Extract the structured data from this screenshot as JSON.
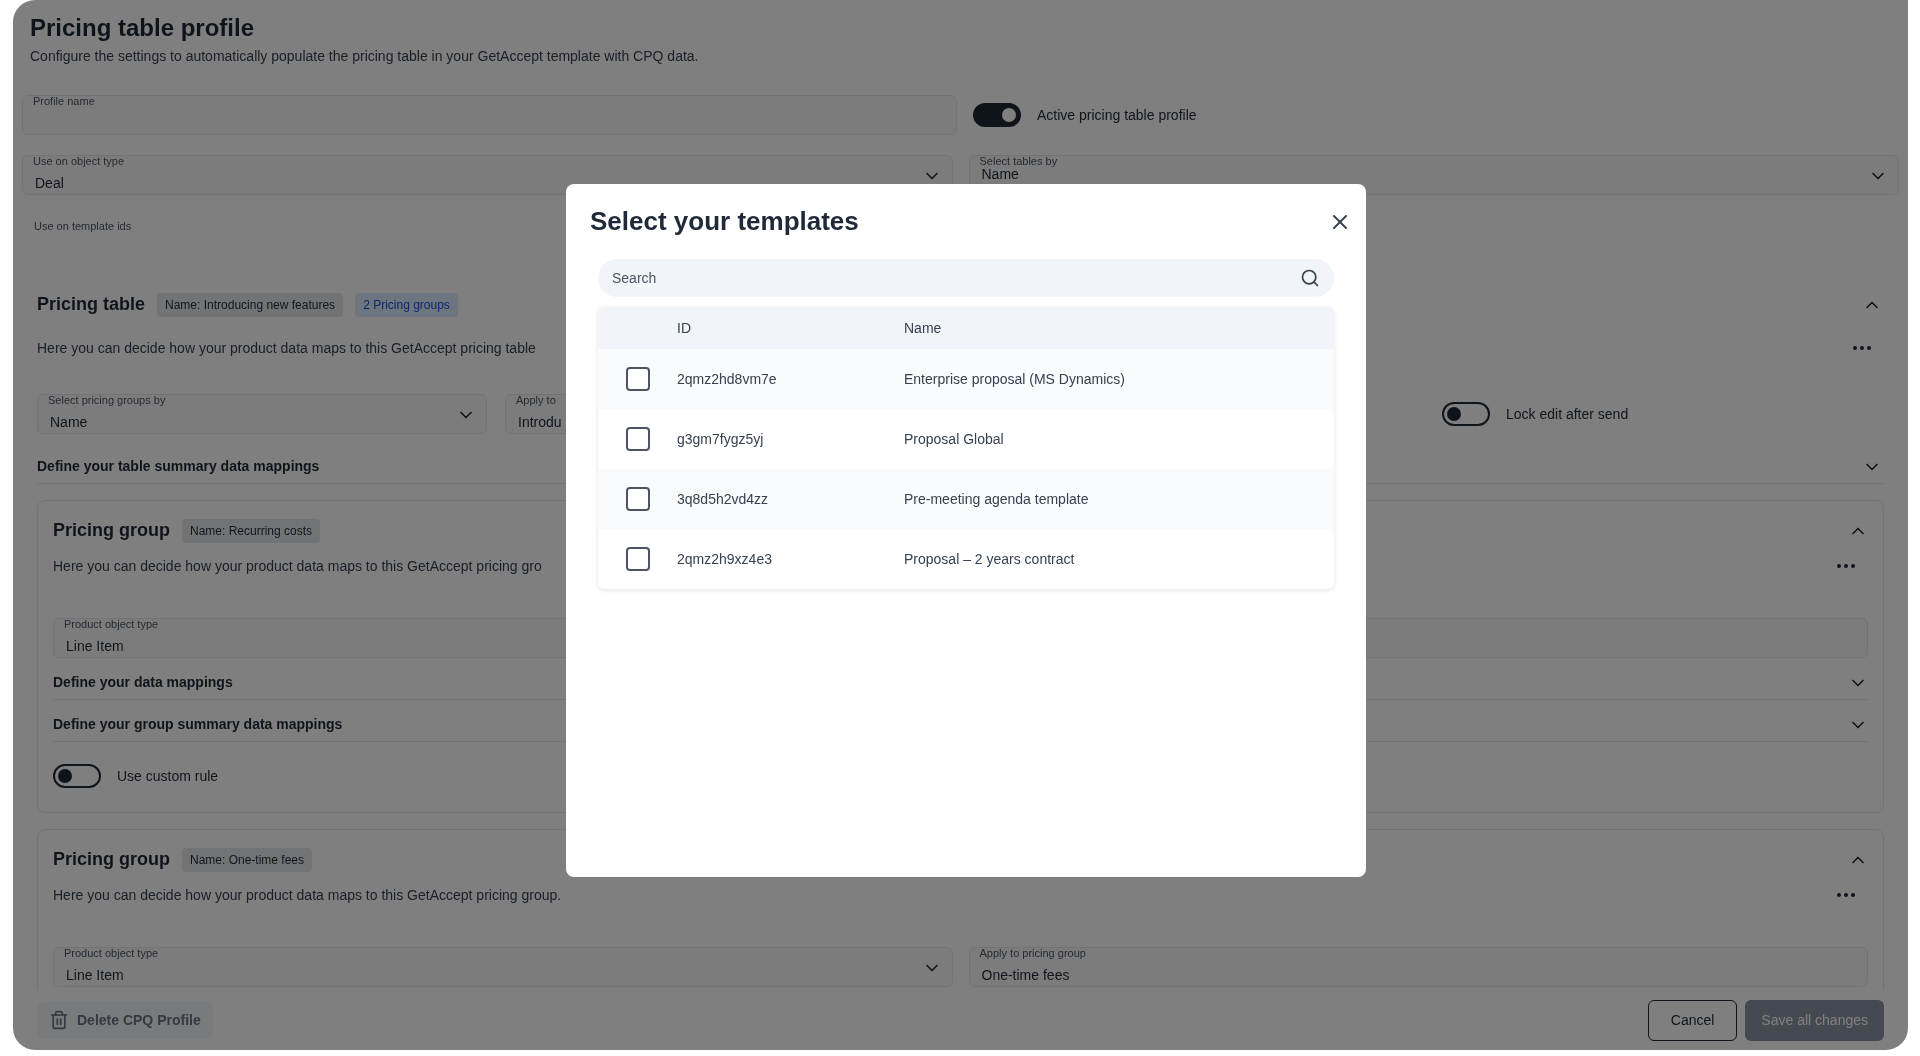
{
  "page": {
    "title": "Pricing table profile",
    "subtitle": "Configure the settings to automatically populate the pricing table in your GetAccept template with CPQ data."
  },
  "profile_name": {
    "label": "Profile name"
  },
  "active_toggle": {
    "label": "Active pricing table profile",
    "on": true
  },
  "object_type": {
    "label": "Use on object type",
    "value": "Deal"
  },
  "tables_by": {
    "label": "Select tables by",
    "value": "Name"
  },
  "template_ids": {
    "label": "Use on template ids"
  },
  "pricing_table": {
    "title": "Pricing table",
    "expanded": true,
    "badges": [
      {
        "text": "Name: Introducing new features",
        "kind": "neutral"
      },
      {
        "text": "2 Pricing groups",
        "kind": "info"
      }
    ],
    "description": "Here you can decide how your product data maps to this GetAccept pricing table",
    "groups_by": {
      "label": "Select pricing groups by",
      "value": "Name"
    },
    "apply_to": {
      "label": "Apply to",
      "value": "Introdu"
    },
    "lock_toggle": {
      "label": "Lock edit after send",
      "on": false
    },
    "summary": {
      "label": "Define your table summary data mappings",
      "expanded": false
    }
  },
  "pricing_groups": [
    {
      "title": "Pricing group",
      "expanded": true,
      "badge": "Name: Recurring costs",
      "description": "Here you can decide how your product data maps to this GetAccept pricing gro",
      "product_type": {
        "label": "Product object type",
        "value": "Line Item"
      },
      "sections": [
        {
          "label": "Define your data mappings",
          "expanded": false
        },
        {
          "label": "Define your group summary data mappings",
          "expanded": false
        }
      ],
      "custom_rule": {
        "label": "Use custom rule",
        "on": false
      }
    },
    {
      "title": "Pricing group",
      "expanded": true,
      "badge": "Name: One-time fees",
      "description": "Here you can decide how your product data maps to this GetAccept pricing group.",
      "product_type": {
        "label": "Product object type",
        "value": "Line Item"
      },
      "apply_group": {
        "label": "Apply to pricing group",
        "value": "One-time fees"
      }
    }
  ],
  "footer": {
    "delete": {
      "label": "Delete CPQ Profile",
      "disabled": true
    },
    "cancel": {
      "label": "Cancel",
      "disabled": false
    },
    "save": {
      "label": "Save all changes",
      "disabled": true
    }
  },
  "modal": {
    "title": "Select your templates",
    "search": {
      "placeholder": "Search"
    },
    "columns": [
      "ID",
      "Name"
    ],
    "rows": [
      {
        "id": "2qmz2hd8vm7e",
        "name": "Enterprise proposal (MS Dynamics)",
        "checked": false
      },
      {
        "id": "g3gm7fygz5yj",
        "name": "Proposal Global",
        "checked": false
      },
      {
        "id": "3q8d5h2vd4zz",
        "name": "Pre-meeting agenda template",
        "checked": false
      },
      {
        "id": "2qmz2h9xz4e3",
        "name": "Proposal – 2 years contract",
        "checked": false
      }
    ]
  }
}
